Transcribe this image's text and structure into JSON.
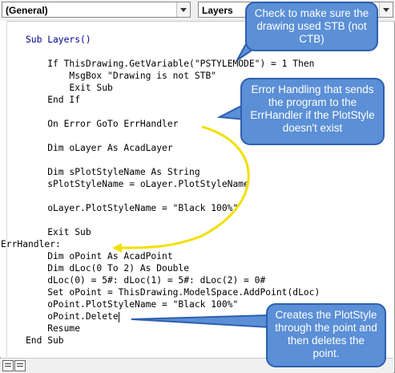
{
  "toolbar": {
    "object_combo": "(General)",
    "procedure_combo": "Layers"
  },
  "code": {
    "lines": [
      "Sub Layers()",
      "",
      "    If ThisDrawing.GetVariable(\"PSTYLEMODE\") = 1 Then",
      "        MsgBox \"Drawing is not STB\"",
      "        Exit Sub",
      "    End If",
      "",
      "    On Error GoTo ErrHandler",
      "",
      "    Dim oLayer As AcadLayer",
      "",
      "    Dim sPlotStyleName As String",
      "    sPlotStyleName = oLayer.PlotStyleName",
      "",
      "    oLayer.PlotStyleName = \"Black 100%\"",
      "",
      "    Exit Sub",
      "ErrHandler:",
      "    Dim oPoint As AcadPoint",
      "    Dim dLoc(0 To 2) As Double",
      "    dLoc(0) = 5#: dLoc(1) = 5#: dLoc(2) = 0#",
      "    Set oPoint = ThisDrawing.ModelSpace.AddPoint(dLoc)",
      "    oPoint.PlotStyleName = \"Black 100%\"",
      "    oPoint.Delete",
      "    Resume",
      "End Sub"
    ]
  },
  "callouts": {
    "stb_check": "Check to make sure the drawing used STB (not CTB)",
    "error_handling": "Error Handling that sends the program to the ErrHandler if the PlotStyle doesn't exist",
    "creates_plotstyle": "Creates the PlotStyle through the point and then deletes the point."
  },
  "colors": {
    "callout_fill": "#5b8fd6",
    "callout_border": "#2f5fb0",
    "arrow": "#f2e000",
    "keyword": "#00008b"
  }
}
